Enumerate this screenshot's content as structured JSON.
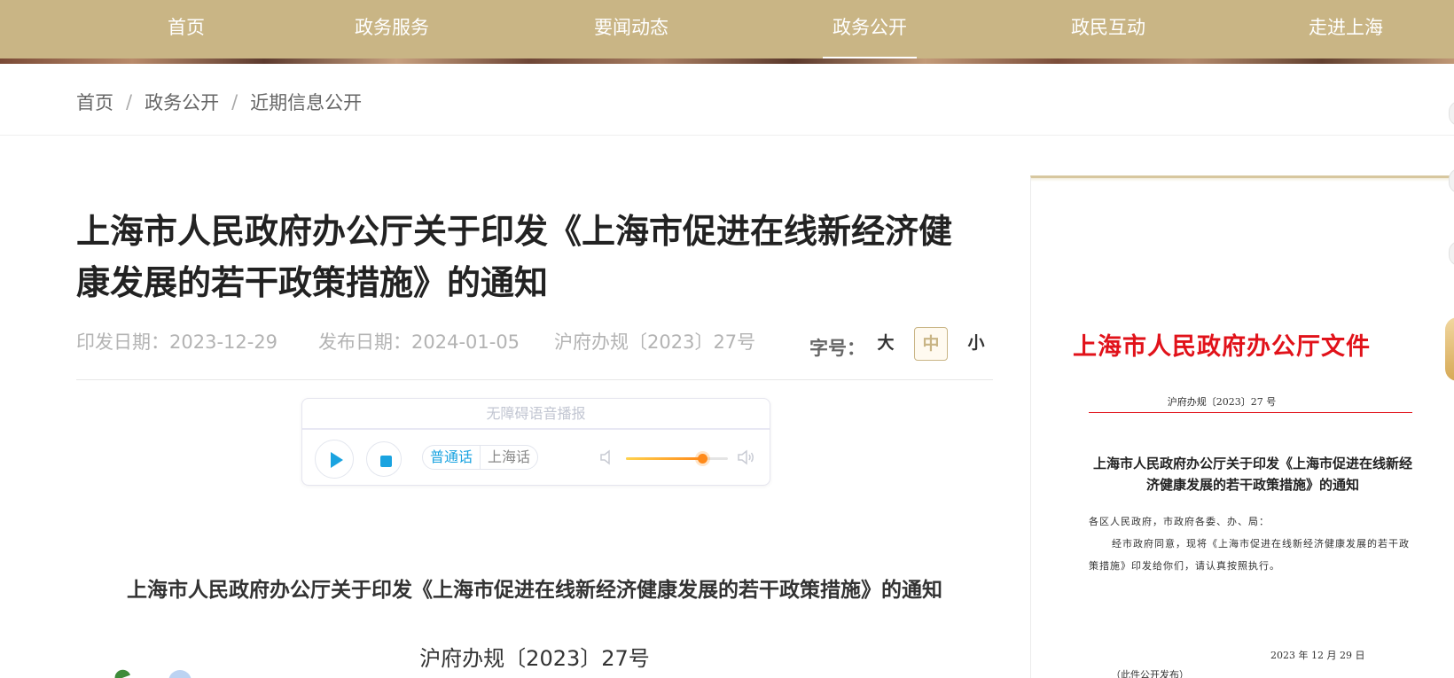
{
  "nav": {
    "items": [
      {
        "label": "首页"
      },
      {
        "label": "政务服务"
      },
      {
        "label": "要闻动态"
      },
      {
        "label": "政务公开",
        "active": true
      },
      {
        "label": "政民互动"
      },
      {
        "label": "走进上海"
      }
    ]
  },
  "breadcrumb": {
    "items": [
      "首页",
      "政务公开",
      "近期信息公开"
    ],
    "separator": "/"
  },
  "article": {
    "title": "上海市人民政府办公厅关于印发《上海市促进在线新经济健康发展的若干政策措施》的通知",
    "issue_date": "印发日期：2023-12-29",
    "publish_date": "发布日期：2024-01-05",
    "doc_number": "沪府办规〔2023〕27号",
    "subtitle": "上海市人民政府办公厅关于印发《上海市促进在线新经济健康发展的若干政策措施》的通知",
    "doc_number_center": "沪府办规〔2023〕27号"
  },
  "font_size": {
    "label": "字号：",
    "options": [
      "大",
      "中",
      "小"
    ],
    "selected": "中"
  },
  "player": {
    "title": "无障碍语音播报",
    "languages": [
      "普通话",
      "上海话"
    ],
    "selected_language": "普通话",
    "volume_fraction": 0.75,
    "icons": [
      "play-icon",
      "stop-icon",
      "volume-low-icon",
      "volume-high-icon"
    ]
  },
  "doc_preview": {
    "header": "上海市人民政府办公厅文件",
    "ref": "沪府办规〔2023〕27 号",
    "title": "上海市人民政府办公厅关于印发《上海市促进在线新经济健康发展的若干政策措施》的通知",
    "recipients": "各区人民政府，市政府各委、办、局：",
    "body": "经市政府同意，现将《上海市促进在线新经济健康发展的若干政策措施》印发给你们，请认真按照执行。",
    "date": "2023 年 12 月 29 日",
    "footnote": "（此件公开发布）"
  },
  "colors": {
    "nav_bg": "#c9b585",
    "accent_blue": "#1aa3e0",
    "doc_red": "#e1121a"
  }
}
